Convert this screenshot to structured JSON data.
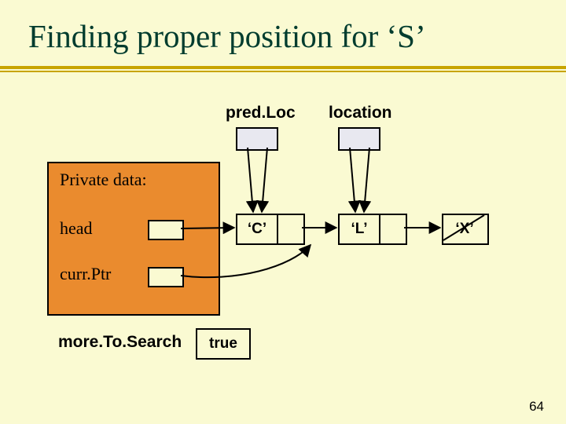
{
  "title": "Finding proper position for ‘S’",
  "labels": {
    "predLoc": "pred.Loc",
    "location": "location",
    "privateData": "Private data:",
    "head": "head",
    "currPtr": "curr.Ptr",
    "moreToSearch": "more.To.Search"
  },
  "nodes": {
    "c": "‘C’",
    "l": "‘L’",
    "x": "‘X’"
  },
  "moreToSearchValue": "true",
  "pageNumber": "64"
}
